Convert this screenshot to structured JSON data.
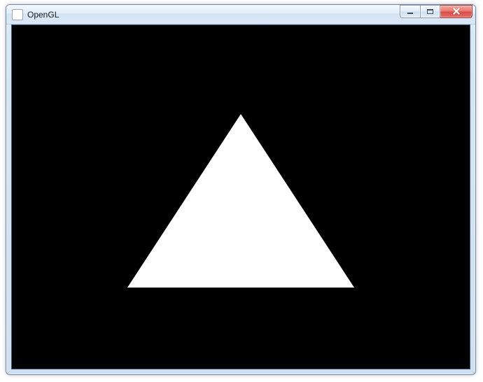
{
  "window": {
    "title": "OpenGL"
  },
  "scene": {
    "background_color": "#000000",
    "shape": "triangle",
    "shape_color": "#ffffff"
  }
}
